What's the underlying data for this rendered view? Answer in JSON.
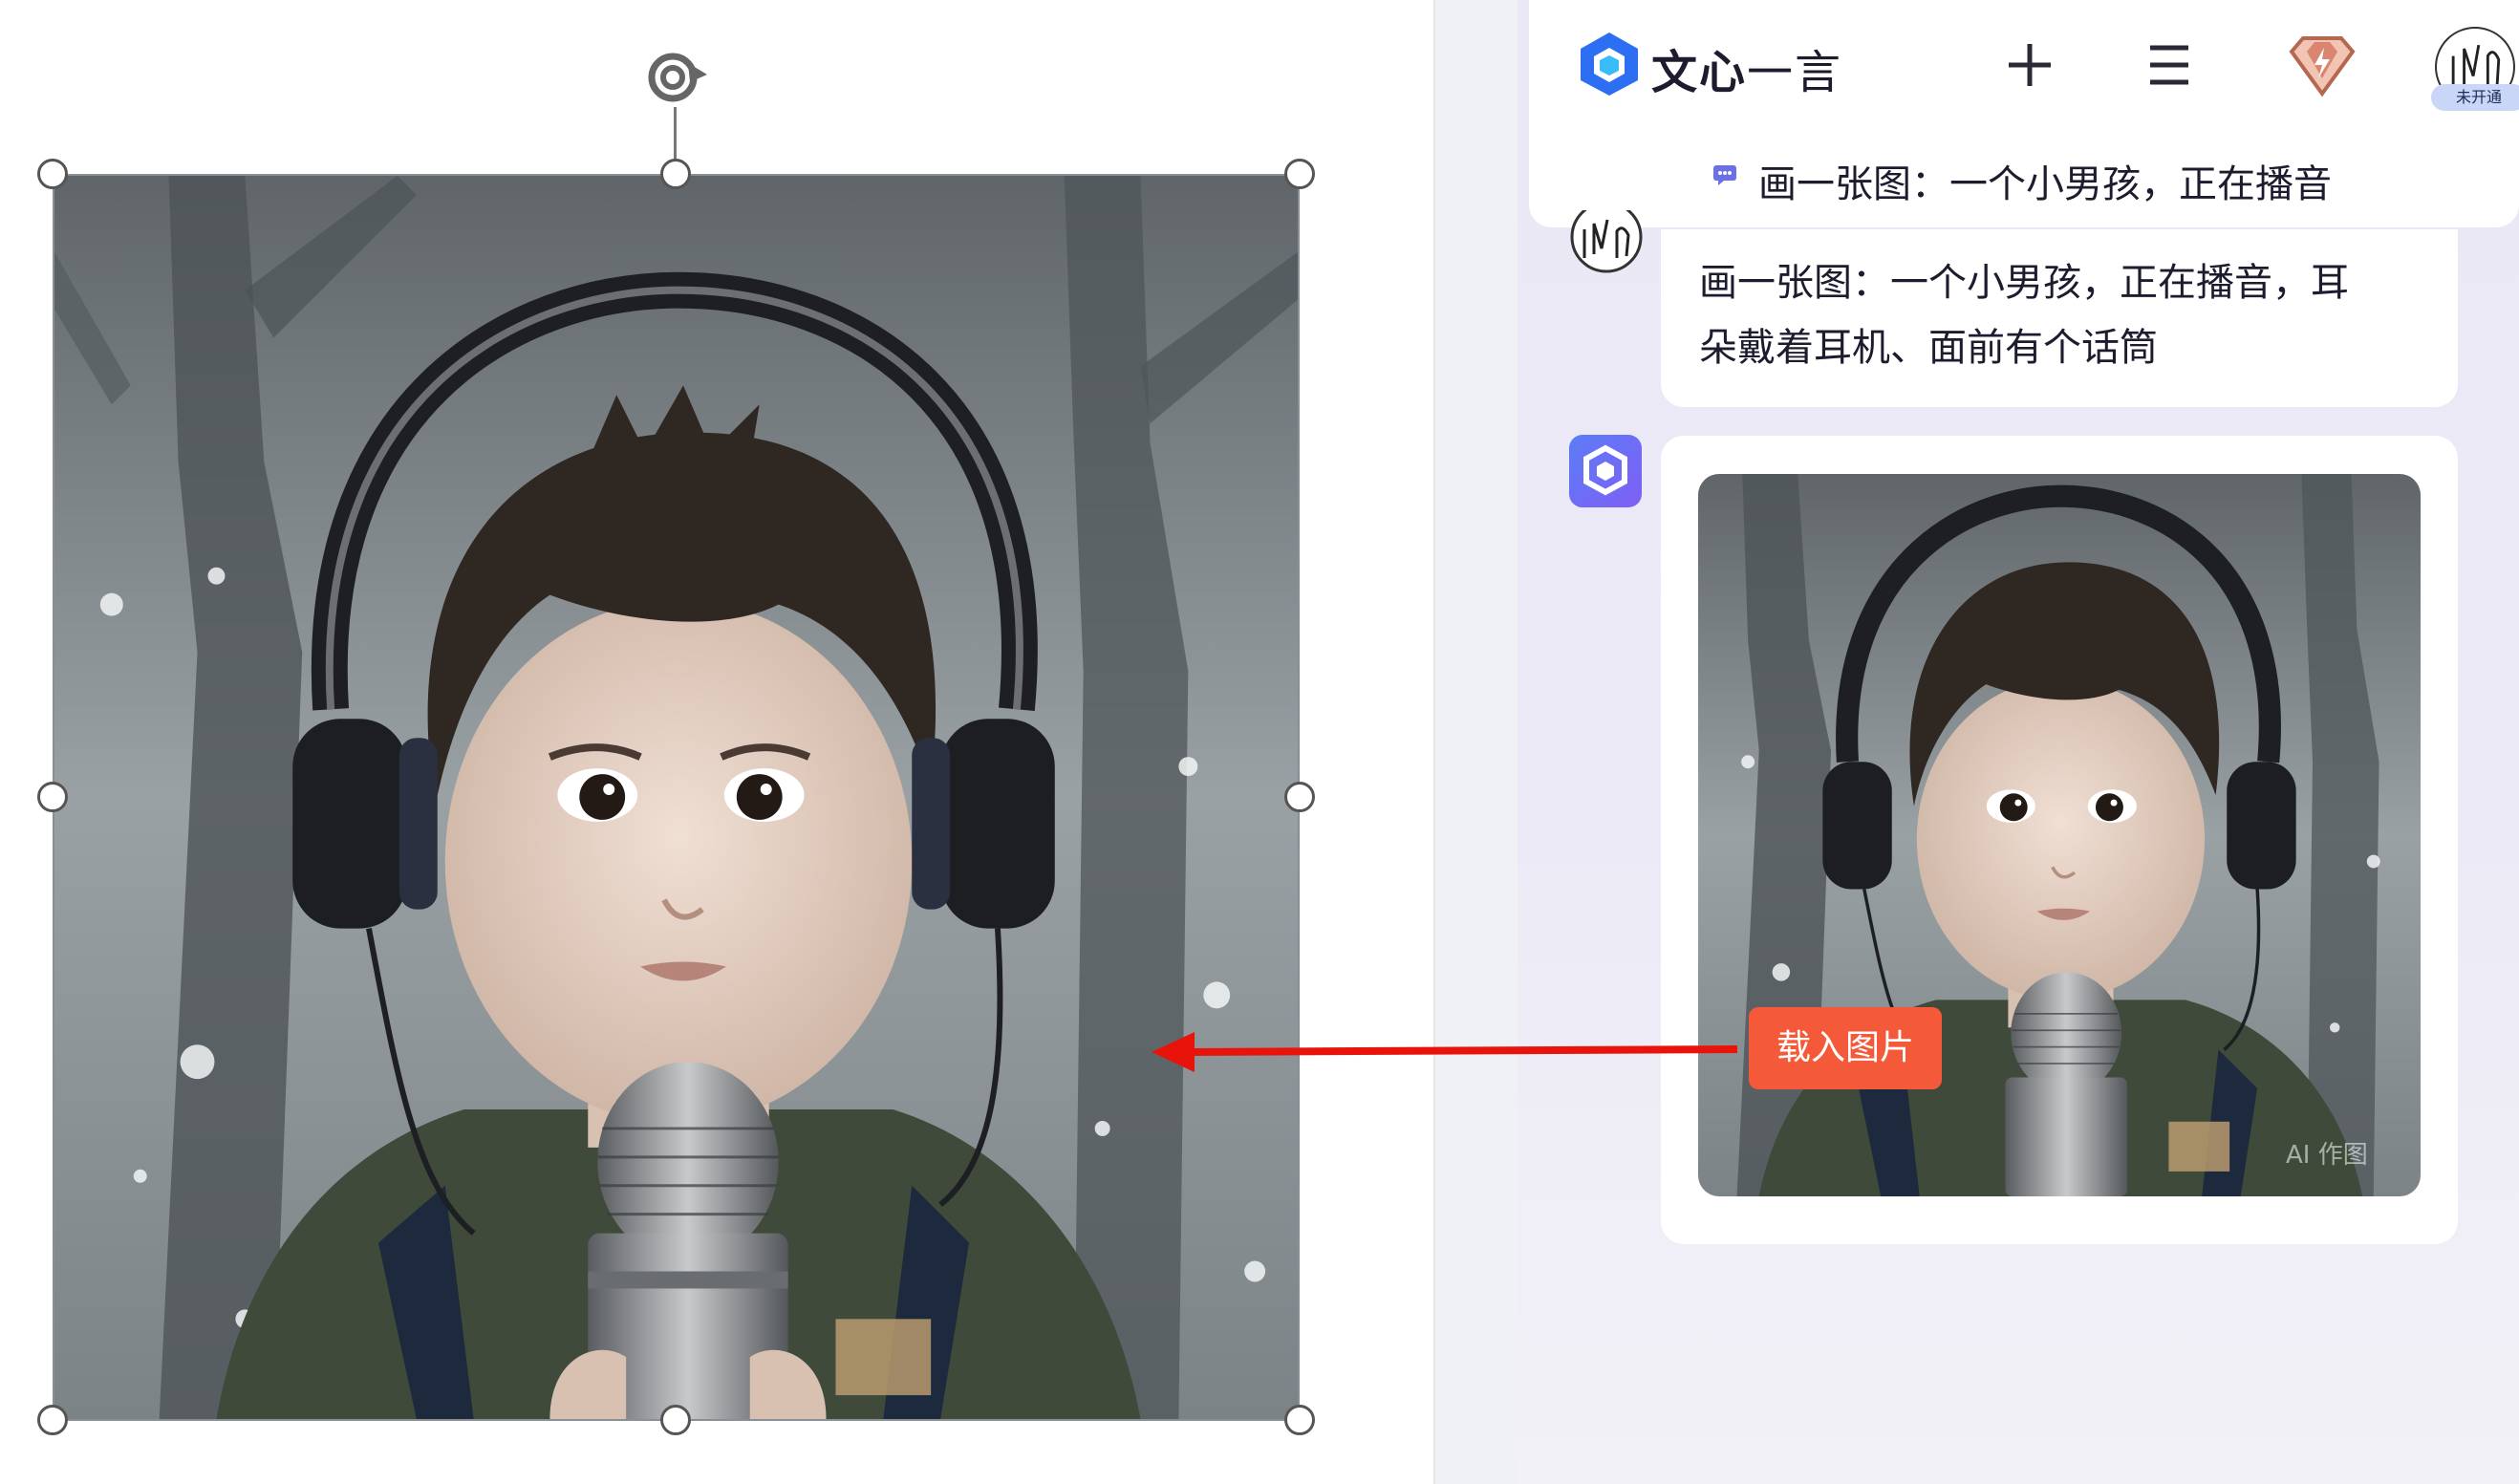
{
  "app": {
    "brand_bold": "文心",
    "brand_light": "一言",
    "status_badge": "未开通"
  },
  "conversation": {
    "topic_title": "画一张图：一个小男孩，正在播音",
    "user_message_line1": "画一张图：一个小男孩，正在播音，耳",
    "user_message_line2": "朵戴着耳机、面前有个话筒",
    "image_watermark": "AI 作图",
    "load_image_button": "载入图片"
  },
  "icons": [
    "logo-icon",
    "plus-icon",
    "menu-icon",
    "gem-icon",
    "avatar",
    "chat-bubble-icon",
    "rotate-icon"
  ],
  "colors": {
    "accent": "#f45a3a",
    "brand_blue": "#2d6ff3",
    "arrow": "#e8140c",
    "panel_bg": "#ebe8f5"
  }
}
